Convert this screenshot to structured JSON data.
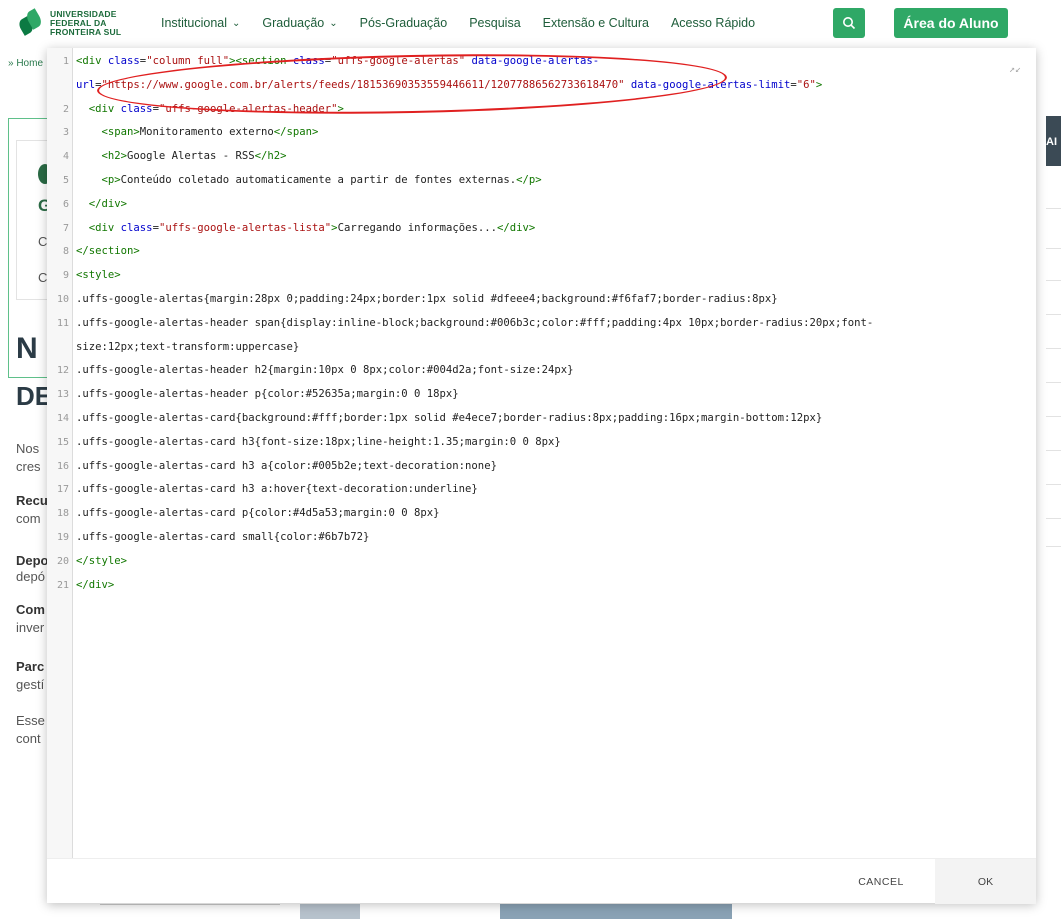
{
  "header": {
    "logo_lines": [
      "UNIVERSIDADE",
      "FEDERAL DA",
      "FRONTEIRA SUL"
    ],
    "nav": [
      {
        "label": "Institucional",
        "dropdown": true
      },
      {
        "label": "Graduação",
        "dropdown": true
      },
      {
        "label": "Pós-Graduação",
        "dropdown": false
      },
      {
        "label": "Pesquisa",
        "dropdown": false
      },
      {
        "label": "Extensão e Cultura",
        "dropdown": false
      },
      {
        "label": "Acesso Rápido",
        "dropdown": false
      }
    ],
    "search_icon": "search-icon",
    "student_area_label": "Área do Aluno",
    "accent_color": "#2fa866"
  },
  "background": {
    "breadcrumb": "» Home",
    "fragments": {
      "g1": "G",
      "c1": "C",
      "c2": "C",
      "big1": "N",
      "big2": "DE",
      "p1": "Nos",
      "p2": "cres",
      "b1": "Recu",
      "p3": "com",
      "b2": "Depo",
      "p4": "depó",
      "b3": "Com",
      "p5": "inver",
      "b4": "Parc",
      "p6": "gestí",
      "p7": "Esse",
      "p8": "cont",
      "right_dark": "AI"
    }
  },
  "editor": {
    "lines": [
      {
        "n": "1",
        "html": "<span class=\"t\">&lt;div</span> <span class=\"a\">class</span>=<span class=\"s\">\"column full\"</span><span class=\"t\">&gt;&lt;section</span> <span class=\"a\">class</span>=<span class=\"s\">\"uffs-google-alertas\"</span> <span class=\"a\">data-google-alertas-</span>"
      },
      {
        "n": "",
        "html": "<span class=\"a\">url</span>=<span class=\"s\">\"https://www.google.com.br/alerts/feeds/18153690353559446611/12077886562733618470\"</span> <span class=\"a\">data-google-alertas-limit</span>=<span class=\"s\">\"6\"</span><span class=\"t\">&gt;</span>"
      },
      {
        "n": "2",
        "html": "  <span class=\"t\">&lt;div</span> <span class=\"a\">class</span>=<span class=\"s\">\"uffs-google-alertas-header\"</span><span class=\"t\">&gt;</span>"
      },
      {
        "n": "3",
        "html": "    <span class=\"t\">&lt;span&gt;</span>Monitoramento externo<span class=\"t\">&lt;/span&gt;</span>"
      },
      {
        "n": "4",
        "html": "    <span class=\"t\">&lt;h2&gt;</span>Google Alertas - RSS<span class=\"t\">&lt;/h2&gt;</span>"
      },
      {
        "n": "5",
        "html": "    <span class=\"t\">&lt;p&gt;</span>Conteúdo coletado automaticamente a partir de fontes externas.<span class=\"t\">&lt;/p&gt;</span>"
      },
      {
        "n": "6",
        "html": "  <span class=\"t\">&lt;/div&gt;</span>"
      },
      {
        "n": "7",
        "html": "  <span class=\"t\">&lt;div</span> <span class=\"a\">class</span>=<span class=\"s\">\"uffs-google-alertas-lista\"</span><span class=\"t\">&gt;</span>Carregando informações...<span class=\"t\">&lt;/div&gt;</span>"
      },
      {
        "n": "8",
        "html": "<span class=\"t\">&lt;/section&gt;</span>"
      },
      {
        "n": "9",
        "html": "<span class=\"t\">&lt;style&gt;</span>"
      },
      {
        "n": "10",
        "html": ".uffs-google-alertas{margin:28px 0;padding:24px;border:1px solid #dfeee4;background:#f6faf7;border-radius:8px}"
      },
      {
        "n": "11",
        "html": ".uffs-google-alertas-header span{display:inline-block;background:#006b3c;color:#fff;padding:4px 10px;border-radius:20px;font-"
      },
      {
        "n": "",
        "html": "size:12px;text-transform:uppercase}"
      },
      {
        "n": "12",
        "html": ".uffs-google-alertas-header h2{margin:10px 0 8px;color:#004d2a;font-size:24px}"
      },
      {
        "n": "13",
        "html": ".uffs-google-alertas-header p{color:#52635a;margin:0 0 18px}"
      },
      {
        "n": "14",
        "html": ".uffs-google-alertas-card{background:#fff;border:1px solid #e4ece7;border-radius:8px;padding:16px;margin-bottom:12px}"
      },
      {
        "n": "15",
        "html": ".uffs-google-alertas-card h3{font-size:18px;line-height:1.35;margin:0 0 8px}"
      },
      {
        "n": "16",
        "html": ".uffs-google-alertas-card h3 a{color:#005b2e;text-decoration:none}"
      },
      {
        "n": "17",
        "html": ".uffs-google-alertas-card h3 a:hover{text-decoration:underline}"
      },
      {
        "n": "18",
        "html": ".uffs-google-alertas-card p{color:#4d5a53;margin:0 0 8px}"
      },
      {
        "n": "19",
        "html": ".uffs-google-alertas-card small{color:#6b7b72}"
      },
      {
        "n": "20",
        "html": "<span class=\"t\">&lt;/style&gt;</span>"
      },
      {
        "n": "21",
        "html": "<span class=\"t\">&lt;/div&gt;</span>"
      }
    ],
    "annotation_color": "#e02020"
  },
  "footer": {
    "cancel_label": "CANCEL",
    "ok_label": "OK"
  }
}
